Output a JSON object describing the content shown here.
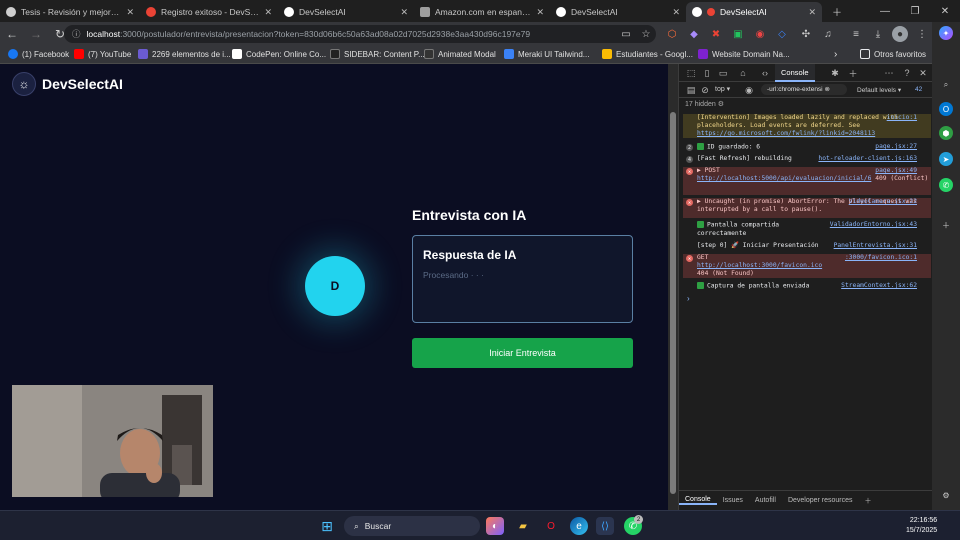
{
  "tabs": [
    {
      "title": "Tesis - Revisión y mejoras ba",
      "color": "#cfcfcf",
      "active": false
    },
    {
      "title": "Registro exitoso - DevSelectA",
      "color": "#ea4335",
      "active": false
    },
    {
      "title": "DevSelectAI",
      "color": "#ffffff",
      "active": false
    },
    {
      "title": "Amazon.com en espanol. Ga",
      "color": "#9e9e9e",
      "active": false
    },
    {
      "title": "DevSelectAI",
      "color": "#ffffff",
      "active": false
    },
    {
      "title": "DevSelectAI",
      "color": "#ffffff",
      "active": true
    }
  ],
  "address": {
    "host": "localhost",
    "path": ":3000/postulador/entrevista/presentacion?token=830d06b6c50a63ad08a02d7025d2938e3aa430d96c197e79"
  },
  "bookmarks": [
    {
      "label": "(1) Facebook",
      "color": "#1877f2"
    },
    {
      "label": "(7) YouTube",
      "color": "#ff0000"
    },
    {
      "label": "2269 elementos de i...",
      "color": "#6b5bd2"
    },
    {
      "label": "CodePen: Online Co...",
      "color": "#ffffff"
    },
    {
      "label": "SIDEBAR: Content P...",
      "color": "#222222"
    },
    {
      "label": "Animated Modal",
      "color": "#333333"
    },
    {
      "label": "Meraki UI Tailwind...",
      "color": "#3b82f6"
    },
    {
      "label": "Estudiantes - Googl...",
      "color": "#fbbc04"
    },
    {
      "label": "Website Domain Na...",
      "color": "#7e22ce"
    },
    {
      "label": "Otros favoritos",
      "color": "#e8eaed"
    }
  ],
  "app": {
    "brand": "DevSelectAI",
    "avatar_letter": "D",
    "interview_title": "Entrevista con IA",
    "response_title": "Respuesta de IA",
    "response_status": "Procesando · · ·",
    "start_button": "Iniciar Entrevista"
  },
  "devtools": {
    "tab": "Console",
    "context": "top",
    "filter": "-url:chrome-extensi",
    "levels": "Default levels",
    "issues_count": "42",
    "hidden": "17 hidden",
    "messages": [
      {
        "type": "warn",
        "text": "[Intervention] Images loaded lazily and replaced with placeholders. Load events are deferred. See",
        "link": "https://go.microsoft.com/fwlink/?linkid=2048113",
        "src": "inicio:1"
      },
      {
        "type": "log",
        "count": "2",
        "check": true,
        "text": "ID guardado: 6",
        "src": "page.jsx:27"
      },
      {
        "type": "log",
        "count": "4",
        "text": "[Fast Refresh] rebuilding",
        "src": "hot-reloader-client.js:163"
      },
      {
        "type": "err",
        "text": "▶ POST",
        "link": "http://localhost:5000/api/evaluacion/inicial/6",
        "extra": "409 (Conflict)",
        "src": "page.jsx:49"
      },
      {
        "type": "err",
        "text": "▶ Uncaught (in promise) AbortError: The play() request was interrupted by a call to pause().",
        "src": "VideoCamara.jsx:22"
      },
      {
        "type": "log",
        "check": true,
        "text": "Pantalla compartida correctamente",
        "src": "ValidadorEntorno.jsx:43"
      },
      {
        "type": "log",
        "text": "[step 0] 🚀 Iniciar Presentación",
        "src": "PanelEntrevista.jsx:31"
      },
      {
        "type": "err",
        "text": "GET",
        "link": "http://localhost:3000/favicon.ico",
        "extra": "404 (Not Found)",
        "src": ":3000/favicon.ico:1"
      },
      {
        "type": "log",
        "check": true,
        "text": "Captura de pantalla enviada",
        "src": "StreamContext.jsx:62"
      }
    ],
    "bottom_tabs": [
      "Console",
      "Issues",
      "Autofill",
      "Developer resources"
    ]
  },
  "taskbar": {
    "search": "Buscar",
    "time": "22:16:56",
    "date": "15/7/2025",
    "badge": "2"
  }
}
